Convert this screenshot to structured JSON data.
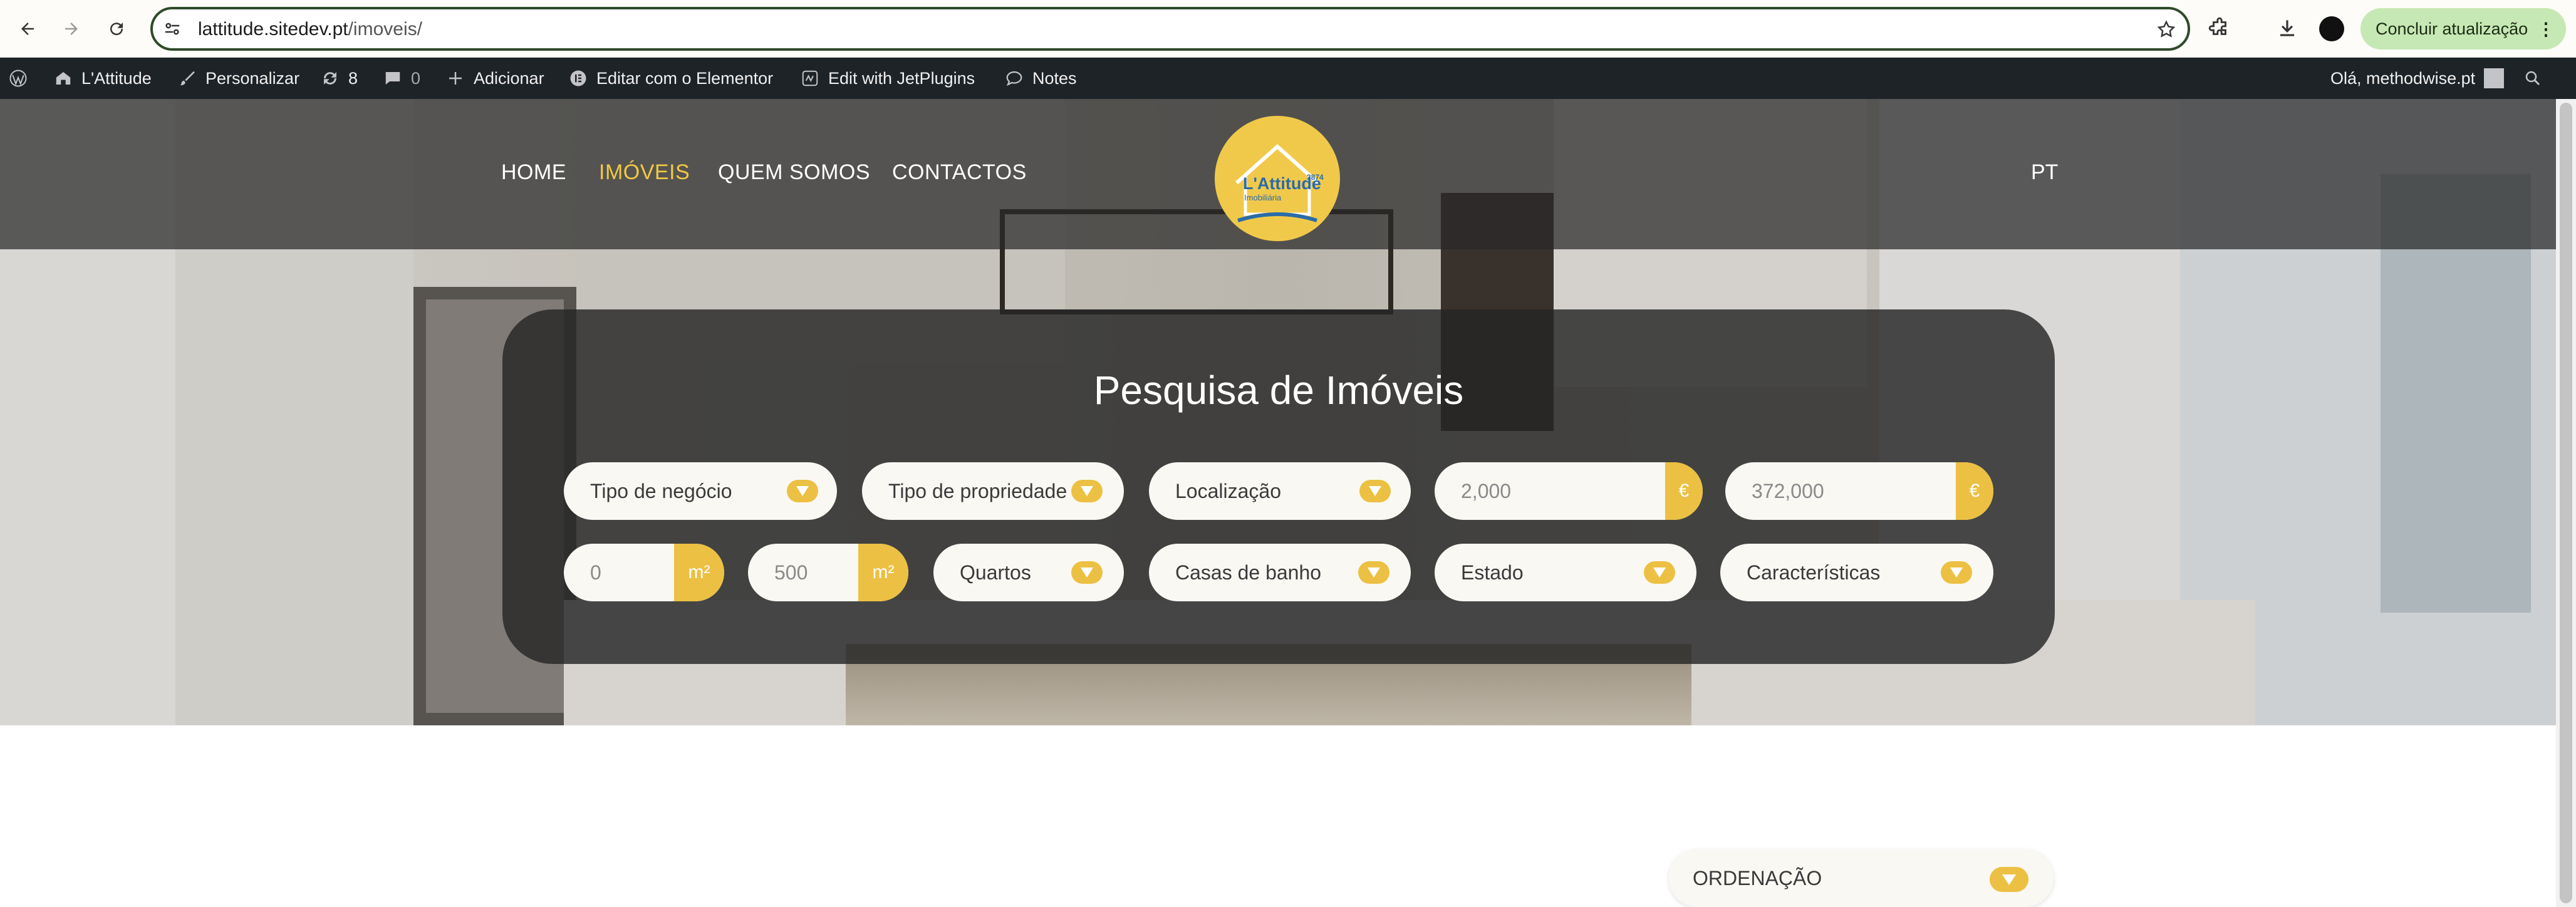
{
  "browser": {
    "url_host": "lattitude.sitedev.pt",
    "url_path": "/imoveis/",
    "update_button": "Concluir atualização"
  },
  "admin_bar": {
    "site_name": "L'Attitude",
    "customize": "Personalizar",
    "updates_count": "8",
    "comments_count": "0",
    "add_new": "Adicionar",
    "elementor": "Editar com o Elementor",
    "jetplugins": "Edit with JetPlugins",
    "notes": "Notes",
    "greeting": "Olá, methodwise.pt"
  },
  "site": {
    "menu": [
      "HOME",
      "IMÓVEIS",
      "QUEM SOMOS",
      "CONTACTOS"
    ],
    "active_menu": "IMÓVEIS",
    "logo_text": "L'Attitude",
    "logo_subtext": "Imobiliária",
    "logo_badge": "3874",
    "language": "PT"
  },
  "search": {
    "title": "Pesquisa de Imóveis",
    "row1": {
      "business_type": "Tipo de negócio",
      "property_type": "Tipo de propriedade",
      "location": "Localização",
      "price_min": "2,000",
      "price_max": "372,000",
      "currency": "€"
    },
    "row2": {
      "area_min": "0",
      "area_max": "500",
      "area_unit": "m²",
      "bedrooms": "Quartos",
      "bathrooms": "Casas de banho",
      "condition": "Estado",
      "features": "Características"
    }
  },
  "sort": {
    "label": "ORDENAÇÃO"
  },
  "colors": {
    "accent": "#ecc043",
    "active_menu": "#f0c845",
    "admin_bar": "#1d2327",
    "update_button": "#c6e8b4"
  }
}
